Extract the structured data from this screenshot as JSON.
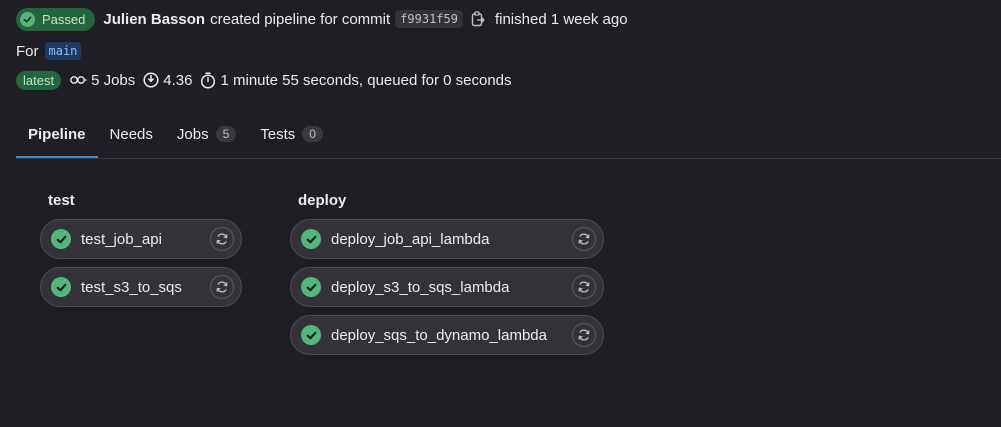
{
  "header": {
    "status": "Passed",
    "author": "Julien Basson",
    "action": "created pipeline for commit",
    "sha": "f9931f59",
    "finished": "finished 1 week ago"
  },
  "ref": {
    "prefix": "For",
    "branch": "main"
  },
  "meta": {
    "latest": "latest",
    "jobs": "5 Jobs",
    "score": "4.36",
    "duration": "1 minute 55 seconds, queued for 0 seconds"
  },
  "tabs": [
    {
      "label": "Pipeline",
      "count": null
    },
    {
      "label": "Needs",
      "count": null
    },
    {
      "label": "Jobs",
      "count": "5"
    },
    {
      "label": "Tests",
      "count": "0"
    }
  ],
  "stages": [
    {
      "title": "test",
      "jobs": [
        {
          "name": "test_job_api"
        },
        {
          "name": "test_s3_to_sqs"
        }
      ]
    },
    {
      "title": "deploy",
      "jobs": [
        {
          "name": "deploy_job_api_lambda"
        },
        {
          "name": "deploy_s3_to_sqs_lambda"
        },
        {
          "name": "deploy_sqs_to_dynamo_lambda"
        }
      ]
    }
  ],
  "colors": {
    "success": "#52b87a",
    "active_tab": "#418cd8",
    "background": "#1f1e24"
  },
  "icons": {
    "status": "check-circle-icon",
    "copy": "copy-icon",
    "jobs": "pipeline-link-icon",
    "score": "gauge-icon",
    "duration": "timer-icon",
    "retry": "retry-icon"
  }
}
